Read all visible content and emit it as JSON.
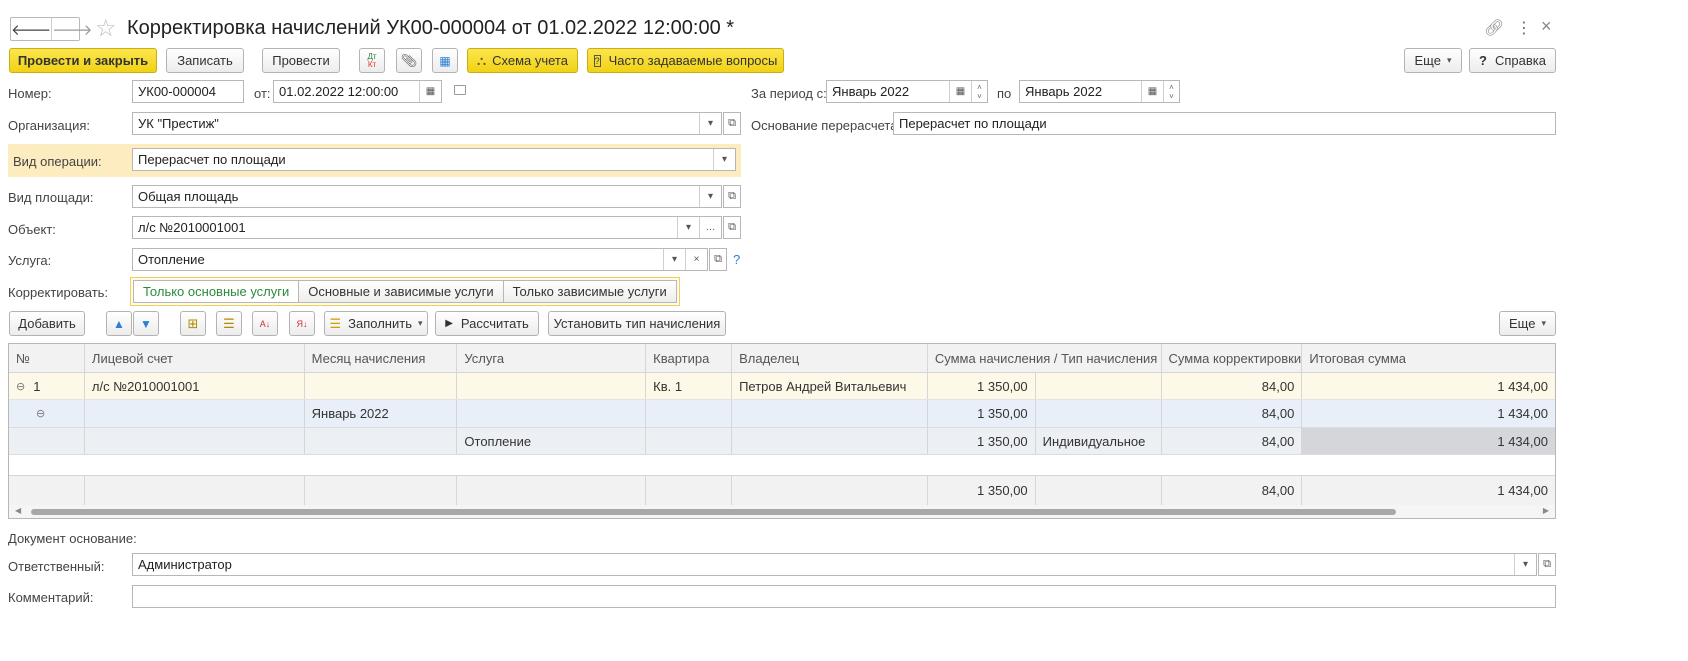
{
  "window": {
    "title": "Корректировка начислений УК00-000004 от 01.02.2022 12:00:00 *"
  },
  "toolbar": {
    "post_close": "Провести и закрыть",
    "save": "Записать",
    "post": "Провести",
    "dt_kt": "Дт Кт",
    "scheme": "Схема учета",
    "faq": "Часто задаваемые вопросы",
    "more": "Еще",
    "help": "Справка"
  },
  "form": {
    "number_label": "Номер:",
    "number": "УК00-000004",
    "from_label": "от:",
    "date": "01.02.2022 12:00:00",
    "period_label": "За период с:",
    "period_from": "Январь 2022",
    "period_to_label": "по",
    "period_to": "Январь 2022",
    "org_label": "Организация:",
    "org": "УК \"Престиж\"",
    "basis_label": "Основание перерасчета:",
    "basis": "Перерасчет по площади",
    "op_label": "Вид операции:",
    "op": "Перерасчет по площади",
    "area_label": "Вид площади:",
    "area": "Общая площадь",
    "object_label": "Объект:",
    "object": "л/с №2010001001",
    "service_label": "Услуга:",
    "service": "Отопление",
    "correct_label": "Корректировать:",
    "correct_options": [
      "Только основные услуги",
      "Основные и зависимые услуги",
      "Только зависимые услуги"
    ],
    "doc_basis_label": "Документ основание:",
    "responsible_label": "Ответственный:",
    "responsible": "Администратор",
    "comment_label": "Комментарий:",
    "comment": ""
  },
  "table_toolbar": {
    "add": "Добавить",
    "fill": "Заполнить",
    "calculate": "Рассчитать",
    "set_type": "Установить тип начисления",
    "more": "Еще"
  },
  "table": {
    "columns": [
      "№",
      "Лицевой счет",
      "Месяц начисления",
      "Услуга",
      "Квартира",
      "Владелец",
      "Сумма начисления / Тип начисления",
      "Сумма корректировки",
      "Итоговая сумма"
    ],
    "row1": {
      "num": "1",
      "account": "л/с №2010001001",
      "apartment": "Кв. 1",
      "owner": "Петров Андрей Витальевич",
      "amount": "1 350,00",
      "correction": "84,00",
      "total": "1 434,00"
    },
    "row2": {
      "month": "Январь 2022",
      "amount": "1 350,00",
      "correction": "84,00",
      "total": "1 434,00"
    },
    "row3": {
      "service": "Отопление",
      "amount": "1 350,00",
      "type": "Индивидуальное",
      "correction": "84,00",
      "total": "1 434,00"
    },
    "footer": {
      "amount": "1 350,00",
      "correction": "84,00",
      "total": "1 434,00"
    }
  }
}
